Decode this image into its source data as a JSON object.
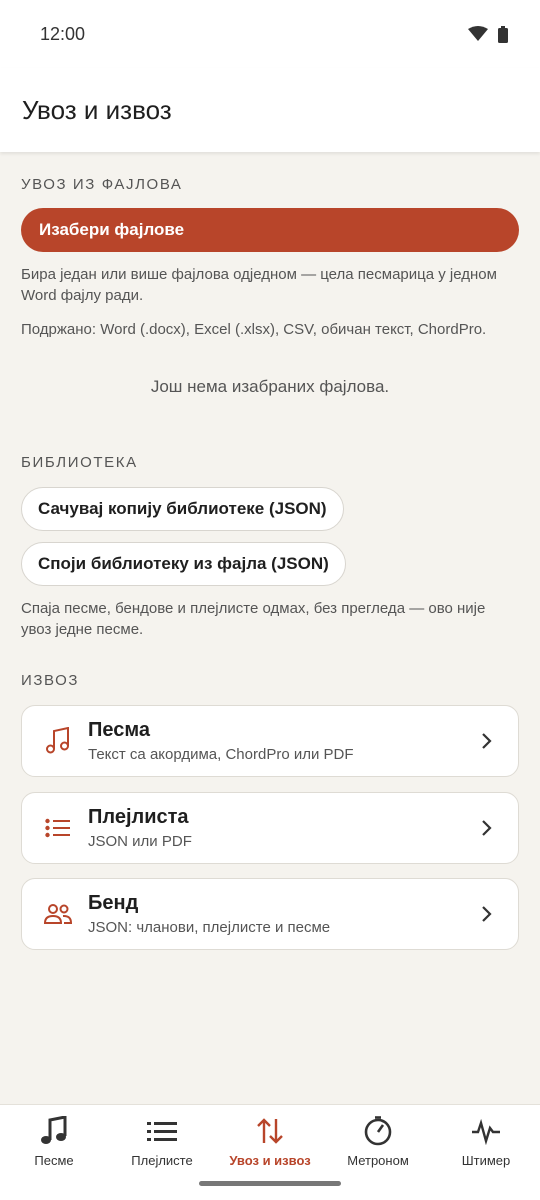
{
  "status_bar": {
    "time": "12:00",
    "icons": [
      "wifi-icon",
      "battery-icon"
    ]
  },
  "app_bar": {
    "title": "Увоз и извоз"
  },
  "import_section": {
    "header": "Увоз из фајлова",
    "choose_button": "Изабери фајлове",
    "help_1": "Бира један или више фајлова одједном — цела песмарица у једном Word фајлу ради.",
    "help_2": "Подржано: Word (.docx), Excel (.xlsx), CSV, обичан текст, ChordPro.",
    "empty": "Још нема изабраних фајлова."
  },
  "library_section": {
    "header": "Библиотека",
    "backup_button": "Сачувај копију библиотеке (JSON)",
    "merge_button": "Споји библиотеку из фајла (JSON)",
    "help": "Спаја песме, бендове и плејлисте одмах, без прегледа — ово није увоз једне песме."
  },
  "export_section": {
    "header": "Извоз",
    "items": [
      {
        "title": "Песма",
        "subtitle": "Текст са акордима, ChordPro или PDF",
        "icon": "music-note-icon"
      },
      {
        "title": "Плејлиста",
        "subtitle": "JSON или PDF",
        "icon": "list-icon"
      },
      {
        "title": "Бенд",
        "subtitle": "JSON: чланови, плејлисте и песме",
        "icon": "people-icon"
      }
    ]
  },
  "bottom_nav": {
    "items": [
      {
        "label": "Песме",
        "icon": "music-note-icon"
      },
      {
        "label": "Плејлисте",
        "icon": "list-icon"
      },
      {
        "label": "Увоз и извоз",
        "icon": "swap-vertical-icon",
        "active": true
      },
      {
        "label": "Метроном",
        "icon": "metronome-icon"
      },
      {
        "label": "Штимер",
        "icon": "pulse-icon"
      }
    ]
  },
  "colors": {
    "accent": "#b8452a",
    "background": "#f5f3ee",
    "surface": "#ffffff"
  }
}
